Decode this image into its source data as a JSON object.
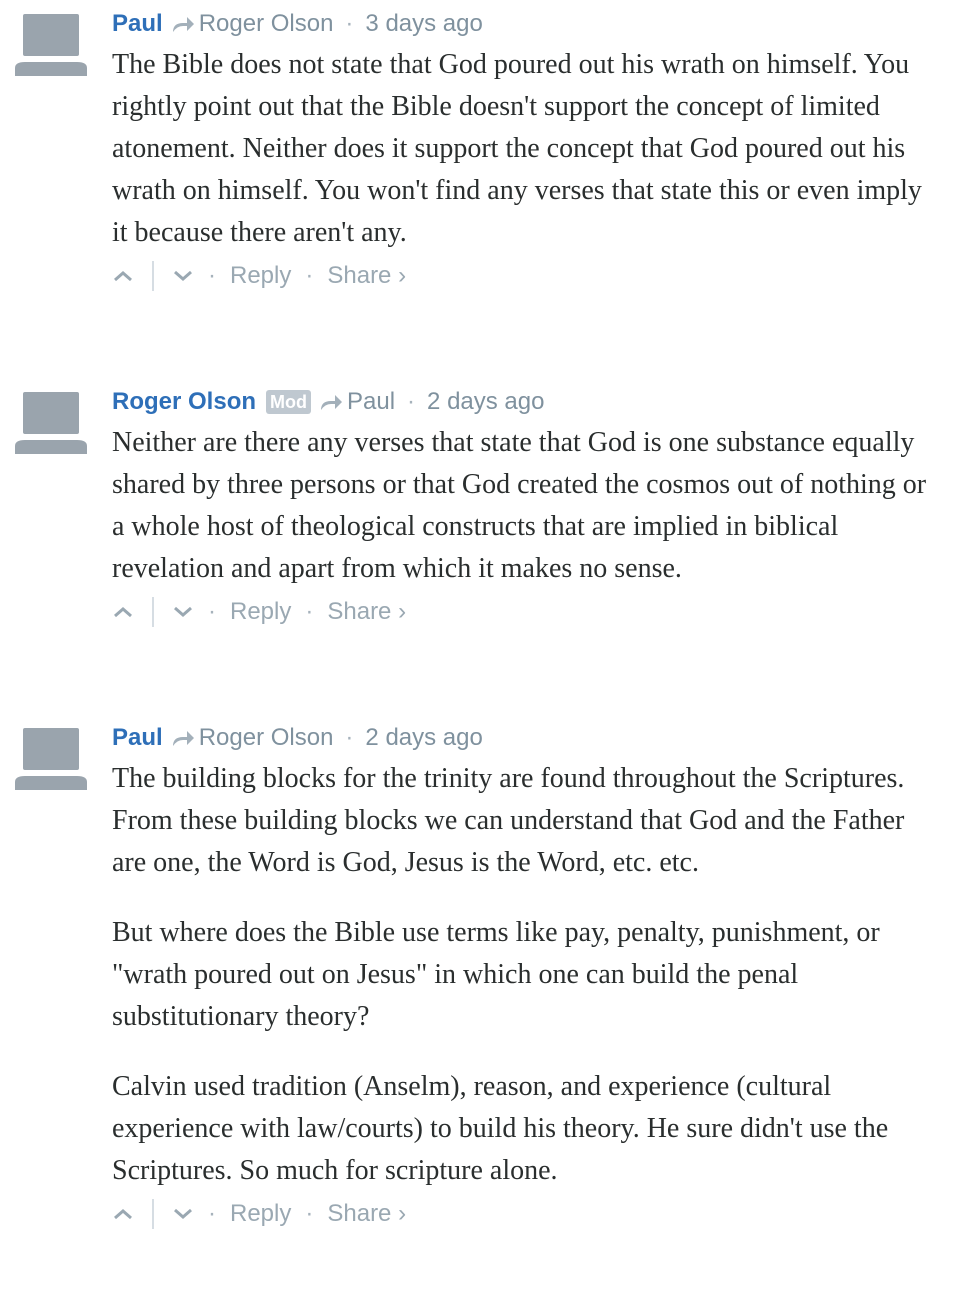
{
  "comments": [
    {
      "author": "Paul",
      "reply_to": "Roger Olson",
      "time": "3 days ago",
      "paragraphs": [
        "The Bible does not state that God poured out his wrath on himself. You rightly point out that the Bible doesn't support the concept of limited atonement. Neither does it support the concept that God poured out his wrath on himself. You won't find any verses that state this or even imply it because there aren't any."
      ],
      "reply_label": "Reply",
      "share_label": "Share ›"
    },
    {
      "author": "Roger Olson",
      "badge": "Mod",
      "reply_to": "Paul",
      "time": "2 days ago",
      "paragraphs": [
        "Neither are there any verses that state that God is one substance equally shared by three persons or that God created the cosmos out of nothing or a whole host of theological constructs that are implied in biblical revelation and apart from which it makes no sense."
      ],
      "reply_label": "Reply",
      "share_label": "Share ›"
    },
    {
      "author": "Paul",
      "reply_to": "Roger Olson",
      "time": "2 days ago",
      "paragraphs": [
        "The building blocks for the trinity are found throughout the Scriptures. From these building blocks we can understand that God and the Father are one, the Word is God, Jesus is the Word, etc. etc.",
        "But where does the Bible use terms like pay, penalty, punishment, or \"wrath poured out on Jesus\" in which one can build the penal substitutionary theory?",
        "Calvin used tradition (Anselm), reason, and experience (cultural experience with law/courts) to build his theory. He sure didn't use the Scriptures. So much for scripture alone."
      ],
      "reply_label": "Reply",
      "share_label": "Share ›"
    }
  ],
  "separator": "·",
  "icons": {
    "avatar": "default-avatar-icon",
    "reply_arrow": "reply-arrow-icon",
    "upvote": "upvote-icon",
    "downvote": "downvote-icon"
  },
  "colors": {
    "author": "#2e6fb8",
    "meta": "#7f919e",
    "body": "#2a2e2e",
    "avatar": "#9aa4ad",
    "badge_bg": "#bfc8d0"
  }
}
